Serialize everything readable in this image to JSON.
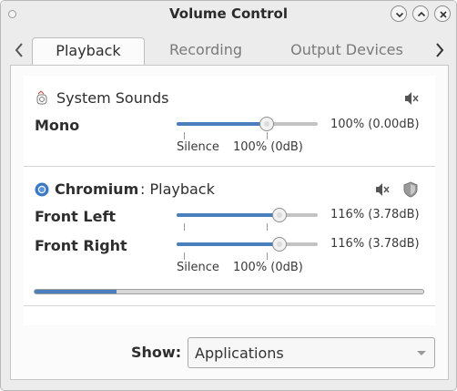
{
  "window": {
    "title": "Volume Control"
  },
  "tabs": [
    {
      "label": "Playback",
      "active": true
    },
    {
      "label": "Recording",
      "active": false
    },
    {
      "label": "Output Devices",
      "active": false
    }
  ],
  "system_sounds": {
    "name": "System Sounds",
    "channel": {
      "label": "Mono",
      "value_text": "100% (0.00dB)",
      "level_percent": 100
    },
    "scale": {
      "silence": "Silence",
      "full": "100% (0dB)"
    },
    "icons": [
      "system-sounds-icon",
      "mute-speaker-icon"
    ]
  },
  "chromium": {
    "app_name": "Chromium",
    "stream_name": ": Playback",
    "channels": [
      {
        "label": "Front Left",
        "value_text": "116% (3.78dB)",
        "level_percent": 116
      },
      {
        "label": "Front Right",
        "value_text": "116% (3.78dB)",
        "level_percent": 116
      }
    ],
    "scale": {
      "silence": "Silence",
      "full": "100% (0dB)"
    },
    "peak_meter_fraction": 0.21,
    "icons": [
      "chromium-icon",
      "mute-speaker-icon",
      "lock-channels-shield-icon"
    ]
  },
  "footer": {
    "show_label": "Show:",
    "show_value": "Applications"
  },
  "colors": {
    "accent": "#4a7fbe",
    "window_bg": "#ececec",
    "panel_bg": "#ffffff"
  }
}
